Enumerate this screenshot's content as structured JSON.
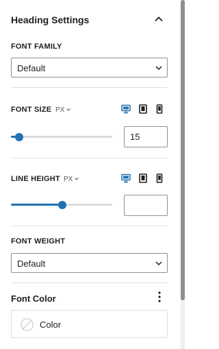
{
  "header": {
    "title": "Heading Settings",
    "icon": "chevron-up-icon"
  },
  "font_family": {
    "label": "FONT FAMILY",
    "value": "Default"
  },
  "font_size": {
    "label": "FONT SIZE",
    "unit": "PX",
    "devices": [
      "desktop-icon",
      "tablet-icon",
      "mobile-icon"
    ],
    "active_device": "desktop",
    "slider_fraction": 0.08,
    "value": "15"
  },
  "line_height": {
    "label": "LINE HEIGHT",
    "unit": "PX",
    "devices": [
      "desktop-icon",
      "tablet-icon",
      "mobile-icon"
    ],
    "active_device": "desktop",
    "slider_fraction": 0.51,
    "value": ""
  },
  "font_weight": {
    "label": "FONT WEIGHT",
    "value": "Default"
  },
  "font_color": {
    "title": "Font Color",
    "swatch_label": "Color",
    "swatch_icon": "no-color-swatch-icon"
  },
  "colors": {
    "accent": "#2271b1",
    "track": "#dcdcde",
    "text": "#1e1e1e",
    "border": "#8c8f94"
  }
}
